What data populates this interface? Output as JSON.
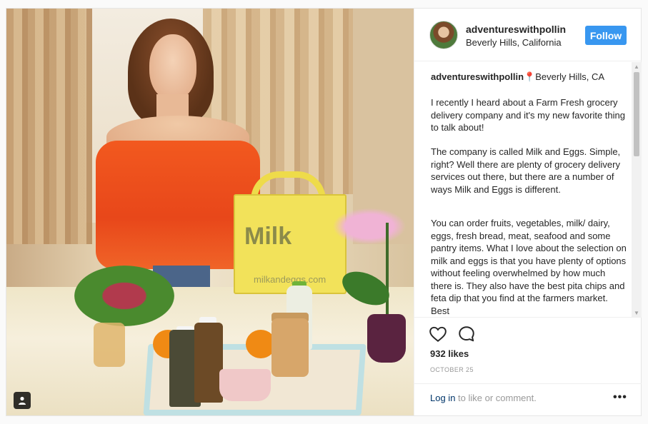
{
  "post": {
    "username": "adventureswithpollin",
    "location": "Beverly Hills, California",
    "follow_label": "Follow",
    "caption": {
      "username": "adventureswithpollin",
      "pin": "📍",
      "location": "Beverly Hills, CA",
      "paragraphs": [
        "I recently I heard about a Farm Fresh grocery delivery company and it's my new favorite thing to talk about!",
        "The company is called Milk and Eggs. Simple, right? Well there are plenty of grocery delivery services out there, but there are a number of ways Milk and Eggs is different.",
        "You can order fruits, vegetables, milk/ dairy, eggs, fresh bread, meat, seafood and some pantry items. What I love about the selection on milk and eggs is that you have plenty of options without feeling overwhelmed by how much there is. They also have the best pita chips and feta dip that you find at the farmers market. Best"
      ]
    },
    "likes": "932 likes",
    "date": "OCTOBER 25",
    "login_link": "Log in",
    "login_rest": " to like or comment.",
    "more": "•••"
  },
  "photo": {
    "bag_logo": "Milk",
    "bag_url": "milkandeggs.com"
  },
  "icons": {
    "heart": "heart-icon",
    "comment": "comment-icon",
    "user_tag": "user-tag-icon"
  },
  "colors": {
    "follow_button": "#3897f0",
    "login_link": "#003569"
  },
  "scrollbar": {
    "up": "▲",
    "down": "▼"
  }
}
